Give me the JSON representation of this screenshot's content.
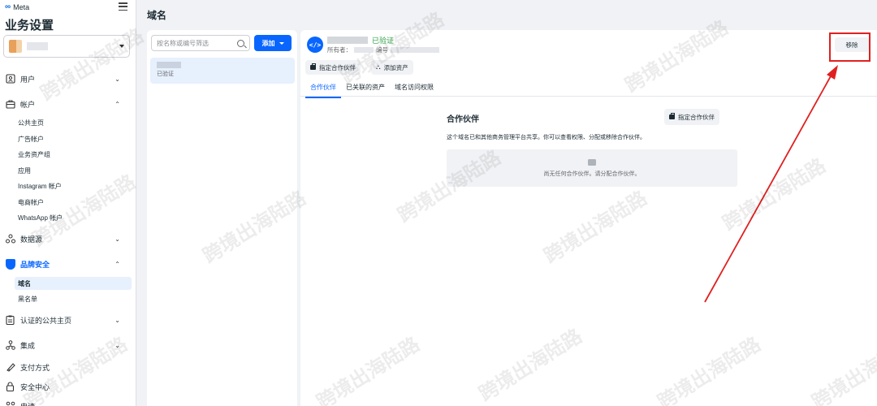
{
  "sidebar": {
    "brand": "Meta",
    "title": "业务设置",
    "groups": {
      "users": "用户",
      "accounts": "帐户",
      "data_sources": "数据源",
      "brand_safety": "品牌安全",
      "verified_pages": "认证的公共主页",
      "integrations": "集成",
      "payments": "支付方式",
      "security_center": "安全中心",
      "requests": "申请"
    },
    "account_items": [
      "公共主页",
      "广告帐户",
      "业务资产组",
      "应用",
      "Instagram 帐户",
      "电商帐户",
      "WhatsApp 帐户"
    ],
    "brand_safety_items": [
      "域名",
      "黑名单"
    ]
  },
  "main": {
    "title": "域名"
  },
  "list": {
    "search_placeholder": "按名称或编号筛选",
    "add_label": "添加",
    "item_status": "已验证"
  },
  "detail": {
    "verified_label": "已验证",
    "owner_label": "所有者：",
    "id_label": "编号",
    "assign_partner_label": "指定合作伙伴",
    "add_assets_label": "添加资产",
    "remove_label": "移除",
    "tabs": [
      "合作伙伴",
      "已关联的资产",
      "域名访问权限"
    ],
    "partners_title": "合作伙伴",
    "partners_assign_label": "指定合作伙伴",
    "partners_desc": "这个域名已和其他商务管理平台共享。你可以查看权限、分配或移除合作伙伴。",
    "empty_text": "尚无任何合作伙伴。请分配合作伙伴。"
  },
  "watermark": "跨境出海陆路",
  "colors": {
    "accent": "#0866ff",
    "verified": "#31a24c",
    "annotation": "#e02020"
  }
}
